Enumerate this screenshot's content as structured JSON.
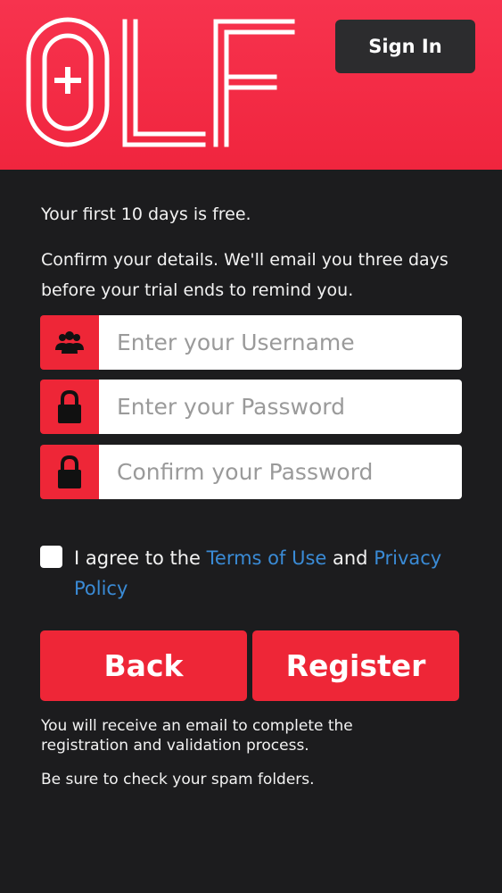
{
  "header": {
    "logo_text": "OLF",
    "signin_label": "Sign In"
  },
  "intro": {
    "line1": "Your first 10 days is free.",
    "line2": "Confirm your details. We'll email you three days before your trial ends to remind you."
  },
  "form": {
    "username_placeholder": "Enter your Username",
    "password_placeholder": "Enter your Password",
    "confirm_placeholder": "Confirm your Password"
  },
  "agree": {
    "prefix": "I agree to the ",
    "terms": "Terms of Use",
    "middle": " and ",
    "privacy": "Privacy Policy"
  },
  "buttons": {
    "back": "Back",
    "register": "Register"
  },
  "notes": {
    "line1": "You will receive an email to complete the registration and validation process.",
    "line2": "Be sure to check your spam folders."
  },
  "colors": {
    "brand_red": "#ee2637",
    "header_red": "#f7334e",
    "background": "#1c1c1e",
    "link_blue": "#3a8bd6"
  },
  "icons": {
    "username": "users-icon",
    "password": "lock-icon",
    "confirm": "lock-icon"
  }
}
